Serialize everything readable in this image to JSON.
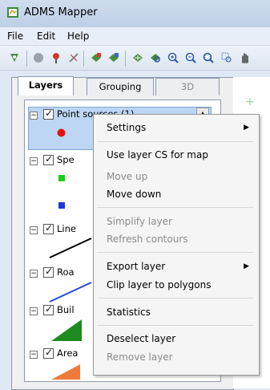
{
  "window": {
    "title": "ADMS Mapper"
  },
  "menu": [
    "File",
    "Edit",
    "Help"
  ],
  "tabs": [
    "Layers",
    "Grouping",
    "3D"
  ],
  "tree": [
    {
      "label": "Point sources (1)"
    },
    {
      "label": "Spe"
    },
    {
      "label": "Line"
    },
    {
      "label": "Roa"
    },
    {
      "label": "Buil"
    },
    {
      "label": "Area"
    }
  ],
  "context_menu": {
    "items": [
      {
        "label": "Settings",
        "submenu": true,
        "enabled": true
      },
      {
        "label": "Use layer CS for map",
        "enabled": true
      },
      {
        "label": "Move up",
        "enabled": false
      },
      {
        "label": "Move down",
        "enabled": true
      },
      {
        "label": "Simplify layer",
        "enabled": false
      },
      {
        "label": "Refresh contours",
        "enabled": false
      },
      {
        "label": "Export layer",
        "submenu": true,
        "enabled": true
      },
      {
        "label": "Clip layer to polygons",
        "enabled": true
      },
      {
        "label": "Statistics",
        "enabled": true
      },
      {
        "label": "Deselect layer",
        "enabled": true
      },
      {
        "label": "Remove layer",
        "enabled": false
      }
    ]
  },
  "toolbar": {
    "icons": [
      "select-tool-icon",
      "info-icon",
      "pin-icon",
      "measure-icon",
      "layer-add-icon",
      "layer-remove-icon",
      "grid-icon",
      "zoom-in-icon",
      "zoom-out-icon",
      "zoom-window-icon",
      "pan-icon"
    ]
  }
}
